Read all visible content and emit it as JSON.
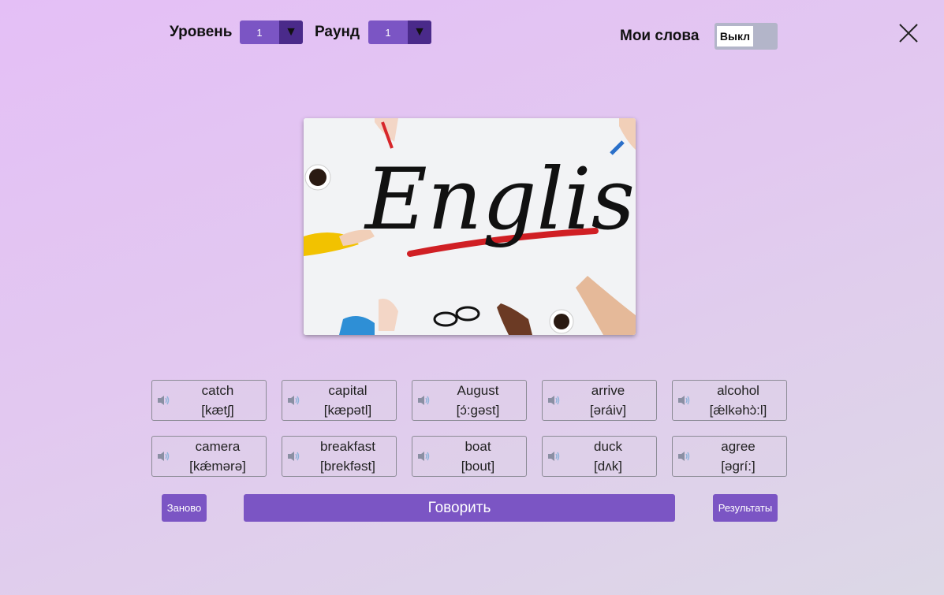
{
  "header": {
    "level_label": "Уровень",
    "level_value": "1",
    "round_label": "Раунд",
    "round_value": "1",
    "my_words_label": "Мои слова",
    "toggle_label": "Выкл"
  },
  "image": {
    "word": "English"
  },
  "cards": [
    {
      "word": "catch",
      "transcription": "[kætʃ]"
    },
    {
      "word": "capital",
      "transcription": "[kæpətl]"
    },
    {
      "word": "August",
      "transcription": "[ɔ́:gəst]"
    },
    {
      "word": "arrive",
      "transcription": "[əráiv]"
    },
    {
      "word": "alcohol",
      "transcription": "[ǽlkəhɔ̀:l]"
    },
    {
      "word": "camera",
      "transcription": "[kǽmərə]"
    },
    {
      "word": "breakfast",
      "transcription": "[brekfəst]"
    },
    {
      "word": "boat",
      "transcription": "[bout]"
    },
    {
      "word": "duck",
      "transcription": "[dʌk]"
    },
    {
      "word": "agree",
      "transcription": "[əgrí:]"
    }
  ],
  "buttons": {
    "restart": "Заново",
    "speak": "Говорить",
    "results": "Результаты"
  },
  "colors": {
    "accent": "#7b55c4",
    "select_arrow_bg": "#4a2a8a"
  }
}
